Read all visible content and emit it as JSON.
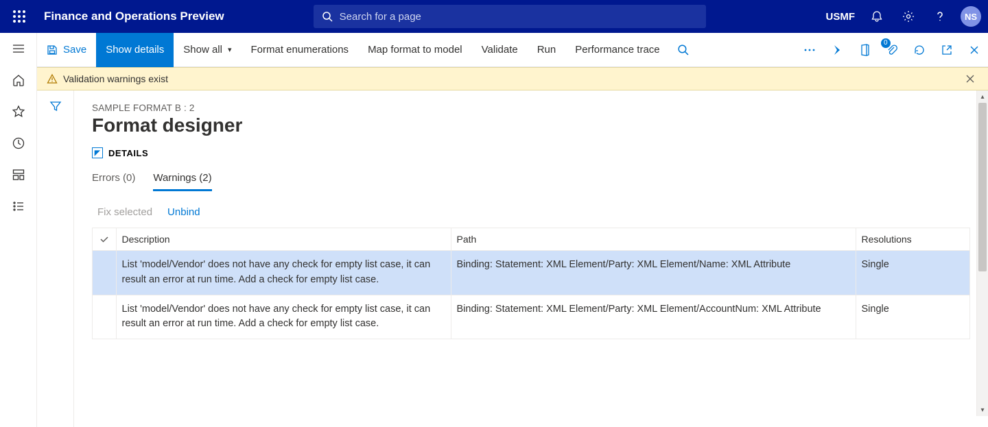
{
  "topbar": {
    "title": "Finance and Operations Preview",
    "search_placeholder": "Search for a page",
    "company": "USMF",
    "avatar": "NS"
  },
  "cmdbar": {
    "save": "Save",
    "show_details": "Show details",
    "show_all": "Show all",
    "format_enum": "Format enumerations",
    "map": "Map format to model",
    "validate": "Validate",
    "run": "Run",
    "perf": "Performance trace",
    "doc_badge": "0"
  },
  "warn": {
    "text": "Validation warnings exist"
  },
  "page": {
    "crumb": "SAMPLE FORMAT B : 2",
    "h1": "Format designer",
    "details_label": "DETAILS",
    "tabs": {
      "errors": "Errors (0)",
      "warnings": "Warnings (2)"
    },
    "subcmds": {
      "fix": "Fix selected",
      "unbind": "Unbind"
    },
    "table": {
      "headers": {
        "description": "Description",
        "path": "Path",
        "resolutions": "Resolutions"
      },
      "rows": [
        {
          "description": "List 'model/Vendor' does not have any check for empty list case, it can result an error at run time. Add a check for empty list case.",
          "path": "Binding: Statement: XML Element/Party: XML Element/Name: XML Attribute",
          "resolutions": "Single"
        },
        {
          "description": "List 'model/Vendor' does not have any check for empty list case, it can result an error at run time. Add a check for empty list case.",
          "path": "Binding: Statement: XML Element/Party: XML Element/AccountNum: XML Attribute",
          "resolutions": "Single"
        }
      ]
    }
  }
}
